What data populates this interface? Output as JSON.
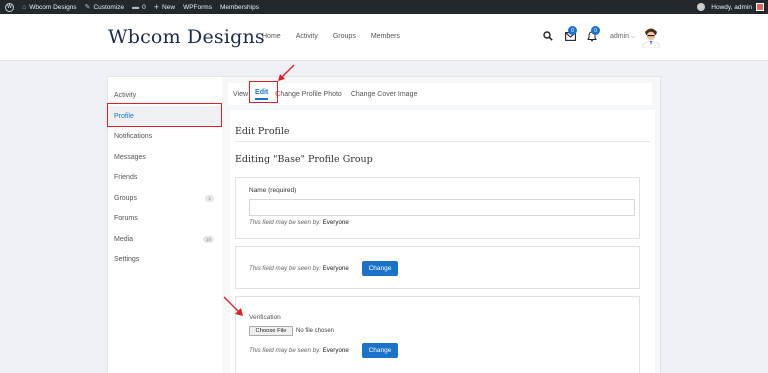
{
  "admin_bar": {
    "site_name": "Wbcom Designs",
    "customize": "Customize",
    "comments_count": "0",
    "new_label": "New",
    "wpforms": "WPForms",
    "memberships": "Memberships",
    "howdy": "Howdy, admin"
  },
  "header": {
    "logo": "Wbcom Designs",
    "nav": [
      "Home",
      "Activity",
      "Groups",
      "Members"
    ],
    "messages_badge": "0",
    "notifications_badge": "0",
    "user_menu": "admin"
  },
  "sidebar": {
    "items": [
      {
        "label": "Activity"
      },
      {
        "label": "Profile"
      },
      {
        "label": "Notifications"
      },
      {
        "label": "Messages"
      },
      {
        "label": "Friends"
      },
      {
        "label": "Groups",
        "count": "1"
      },
      {
        "label": "Forums"
      },
      {
        "label": "Media",
        "count": "10"
      },
      {
        "label": "Settings"
      }
    ],
    "active": "Profile"
  },
  "subnav": {
    "view": "View",
    "edit": "Edit",
    "change_photo": "Change Profile Photo",
    "change_cover": "Change Cover Image"
  },
  "form": {
    "title": "Edit Profile",
    "group_title": "Editing \"Base\" Profile Group",
    "field_name_label": "Name (required)",
    "field_name_value": "",
    "visibility_prefix": "This field may be seen by:",
    "visibility_value": "Everyone",
    "change_label": "Change",
    "verification_label": "Verification",
    "choose_file": "Choose File",
    "no_file": "No file chosen"
  },
  "colors": {
    "accent": "#1a73c9",
    "annotation_red": "#e0202a",
    "admin_bar_bg": "#23282d"
  }
}
